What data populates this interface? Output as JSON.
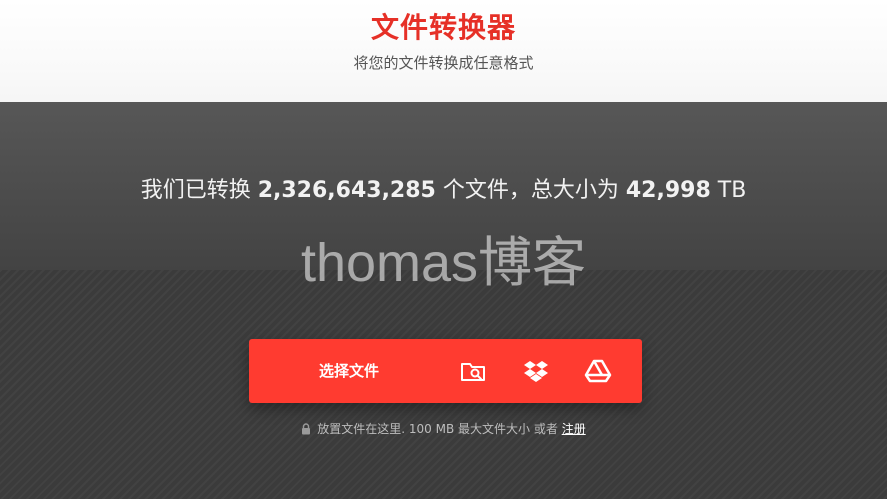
{
  "header": {
    "title": "文件转换器",
    "subtitle": "将您的文件转换成任意格式"
  },
  "stats": {
    "prefix": "我们已转换",
    "file_count": "2,326,643,285",
    "middle": "个文件，总大小为",
    "total_size": "42,998",
    "unit": "TB"
  },
  "watermark": "thomas博客",
  "upload": {
    "choose_label": "选择文件",
    "sources": [
      "folder-search-icon",
      "dropbox-icon",
      "google-drive-icon"
    ]
  },
  "note": {
    "text": "放置文件在这里. 100 MB 最大文件大小 或者",
    "register_link": "注册"
  },
  "colors": {
    "accent": "#ff3b30",
    "title": "#e63027",
    "hero_bg": "#3a3a3a"
  }
}
